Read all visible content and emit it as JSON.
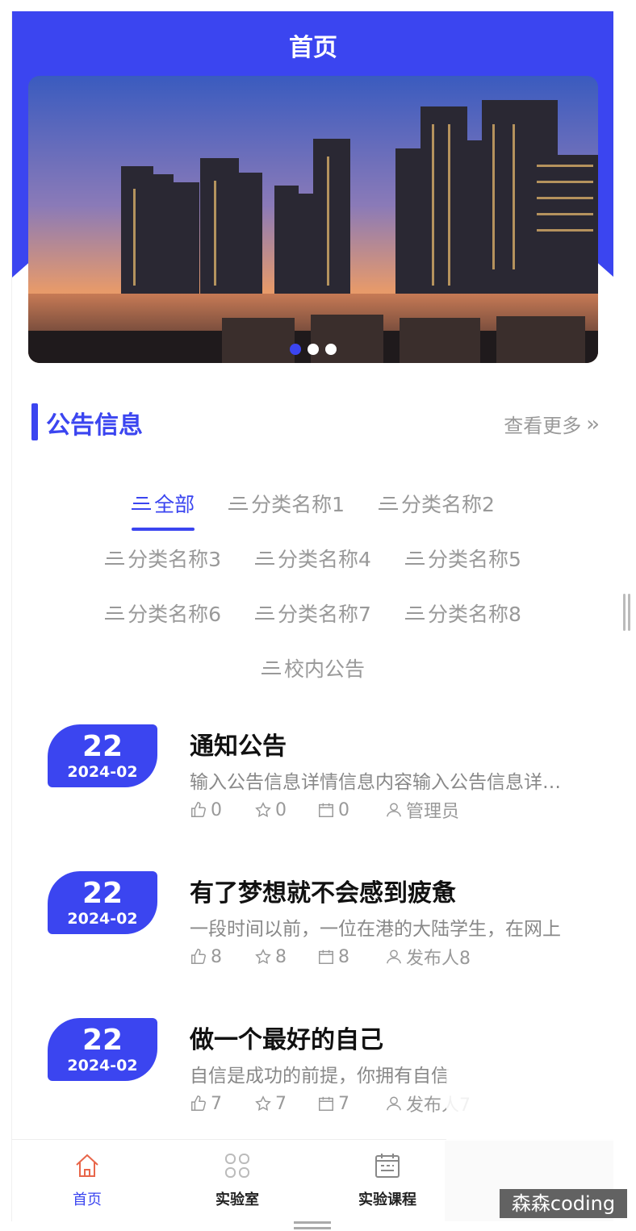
{
  "nav": {
    "title": "首页"
  },
  "banner": {
    "image": "city-skyline-night",
    "dots": 3,
    "active_dot": 0
  },
  "section": {
    "title": "公告信息",
    "more_label": "查看更多"
  },
  "categories": {
    "rows": [
      [
        {
          "label": "全部",
          "active": true
        },
        {
          "label": "分类名称1"
        },
        {
          "label": "分类名称2"
        }
      ],
      [
        {
          "label": "分类名称3"
        },
        {
          "label": "分类名称4"
        },
        {
          "label": "分类名称5"
        }
      ],
      [
        {
          "label": "分类名称6"
        },
        {
          "label": "分类名称7"
        },
        {
          "label": "分类名称8"
        }
      ],
      [
        {
          "label": "校内公告"
        }
      ]
    ]
  },
  "notices": [
    {
      "day": "22",
      "ym": "2024-02",
      "title": "通知公告",
      "desc": "输入公告信息详情信息内容输入公告信息详情信息内容",
      "likes": "0",
      "stars": "0",
      "views": "0",
      "author": "管理员"
    },
    {
      "day": "22",
      "ym": "2024-02",
      "title": "有了梦想就不会感到疲惫",
      "desc": "一段时间以前，一位在港的大陆学生，在网上",
      "likes": "8",
      "stars": "8",
      "views": "8",
      "author": "发布人8"
    },
    {
      "day": "22",
      "ym": "2024-02",
      "title": "做一个最好的自己",
      "desc": "自信是成功的前提，你拥有自信",
      "likes": "7",
      "stars": "7",
      "views": "7",
      "author": "发布人7"
    }
  ],
  "tabbar": [
    {
      "label": "首页",
      "icon": "home-icon",
      "active": true
    },
    {
      "label": "实验室",
      "icon": "grid-icon"
    },
    {
      "label": "实验课程",
      "icon": "calendar-icon"
    },
    {
      "label": "",
      "icon": "user-icon"
    }
  ],
  "watermark": "森森coding",
  "colors": {
    "primary": "#3b45f0",
    "muted": "#999999"
  }
}
